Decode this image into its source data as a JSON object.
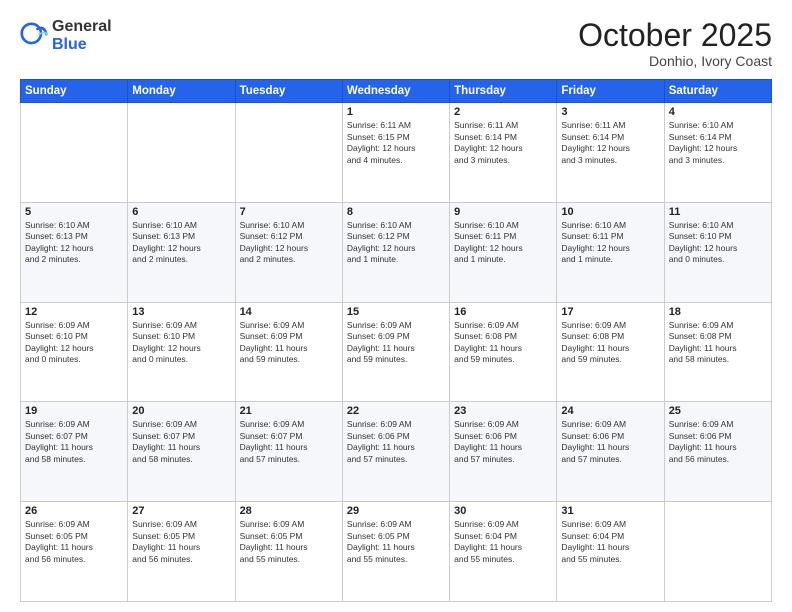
{
  "header": {
    "logo_general": "General",
    "logo_blue": "Blue",
    "title": "October 2025",
    "location": "Donhio, Ivory Coast"
  },
  "weekdays": [
    "Sunday",
    "Monday",
    "Tuesday",
    "Wednesday",
    "Thursday",
    "Friday",
    "Saturday"
  ],
  "weeks": [
    [
      {
        "day": "",
        "info": ""
      },
      {
        "day": "",
        "info": ""
      },
      {
        "day": "",
        "info": ""
      },
      {
        "day": "1",
        "info": "Sunrise: 6:11 AM\nSunset: 6:15 PM\nDaylight: 12 hours\nand 4 minutes."
      },
      {
        "day": "2",
        "info": "Sunrise: 6:11 AM\nSunset: 6:14 PM\nDaylight: 12 hours\nand 3 minutes."
      },
      {
        "day": "3",
        "info": "Sunrise: 6:11 AM\nSunset: 6:14 PM\nDaylight: 12 hours\nand 3 minutes."
      },
      {
        "day": "4",
        "info": "Sunrise: 6:10 AM\nSunset: 6:14 PM\nDaylight: 12 hours\nand 3 minutes."
      }
    ],
    [
      {
        "day": "5",
        "info": "Sunrise: 6:10 AM\nSunset: 6:13 PM\nDaylight: 12 hours\nand 2 minutes."
      },
      {
        "day": "6",
        "info": "Sunrise: 6:10 AM\nSunset: 6:13 PM\nDaylight: 12 hours\nand 2 minutes."
      },
      {
        "day": "7",
        "info": "Sunrise: 6:10 AM\nSunset: 6:12 PM\nDaylight: 12 hours\nand 2 minutes."
      },
      {
        "day": "8",
        "info": "Sunrise: 6:10 AM\nSunset: 6:12 PM\nDaylight: 12 hours\nand 1 minute."
      },
      {
        "day": "9",
        "info": "Sunrise: 6:10 AM\nSunset: 6:11 PM\nDaylight: 12 hours\nand 1 minute."
      },
      {
        "day": "10",
        "info": "Sunrise: 6:10 AM\nSunset: 6:11 PM\nDaylight: 12 hours\nand 1 minute."
      },
      {
        "day": "11",
        "info": "Sunrise: 6:10 AM\nSunset: 6:10 PM\nDaylight: 12 hours\nand 0 minutes."
      }
    ],
    [
      {
        "day": "12",
        "info": "Sunrise: 6:09 AM\nSunset: 6:10 PM\nDaylight: 12 hours\nand 0 minutes."
      },
      {
        "day": "13",
        "info": "Sunrise: 6:09 AM\nSunset: 6:10 PM\nDaylight: 12 hours\nand 0 minutes."
      },
      {
        "day": "14",
        "info": "Sunrise: 6:09 AM\nSunset: 6:09 PM\nDaylight: 11 hours\nand 59 minutes."
      },
      {
        "day": "15",
        "info": "Sunrise: 6:09 AM\nSunset: 6:09 PM\nDaylight: 11 hours\nand 59 minutes."
      },
      {
        "day": "16",
        "info": "Sunrise: 6:09 AM\nSunset: 6:08 PM\nDaylight: 11 hours\nand 59 minutes."
      },
      {
        "day": "17",
        "info": "Sunrise: 6:09 AM\nSunset: 6:08 PM\nDaylight: 11 hours\nand 59 minutes."
      },
      {
        "day": "18",
        "info": "Sunrise: 6:09 AM\nSunset: 6:08 PM\nDaylight: 11 hours\nand 58 minutes."
      }
    ],
    [
      {
        "day": "19",
        "info": "Sunrise: 6:09 AM\nSunset: 6:07 PM\nDaylight: 11 hours\nand 58 minutes."
      },
      {
        "day": "20",
        "info": "Sunrise: 6:09 AM\nSunset: 6:07 PM\nDaylight: 11 hours\nand 58 minutes."
      },
      {
        "day": "21",
        "info": "Sunrise: 6:09 AM\nSunset: 6:07 PM\nDaylight: 11 hours\nand 57 minutes."
      },
      {
        "day": "22",
        "info": "Sunrise: 6:09 AM\nSunset: 6:06 PM\nDaylight: 11 hours\nand 57 minutes."
      },
      {
        "day": "23",
        "info": "Sunrise: 6:09 AM\nSunset: 6:06 PM\nDaylight: 11 hours\nand 57 minutes."
      },
      {
        "day": "24",
        "info": "Sunrise: 6:09 AM\nSunset: 6:06 PM\nDaylight: 11 hours\nand 57 minutes."
      },
      {
        "day": "25",
        "info": "Sunrise: 6:09 AM\nSunset: 6:06 PM\nDaylight: 11 hours\nand 56 minutes."
      }
    ],
    [
      {
        "day": "26",
        "info": "Sunrise: 6:09 AM\nSunset: 6:05 PM\nDaylight: 11 hours\nand 56 minutes."
      },
      {
        "day": "27",
        "info": "Sunrise: 6:09 AM\nSunset: 6:05 PM\nDaylight: 11 hours\nand 56 minutes."
      },
      {
        "day": "28",
        "info": "Sunrise: 6:09 AM\nSunset: 6:05 PM\nDaylight: 11 hours\nand 55 minutes."
      },
      {
        "day": "29",
        "info": "Sunrise: 6:09 AM\nSunset: 6:05 PM\nDaylight: 11 hours\nand 55 minutes."
      },
      {
        "day": "30",
        "info": "Sunrise: 6:09 AM\nSunset: 6:04 PM\nDaylight: 11 hours\nand 55 minutes."
      },
      {
        "day": "31",
        "info": "Sunrise: 6:09 AM\nSunset: 6:04 PM\nDaylight: 11 hours\nand 55 minutes."
      },
      {
        "day": "",
        "info": ""
      }
    ]
  ]
}
